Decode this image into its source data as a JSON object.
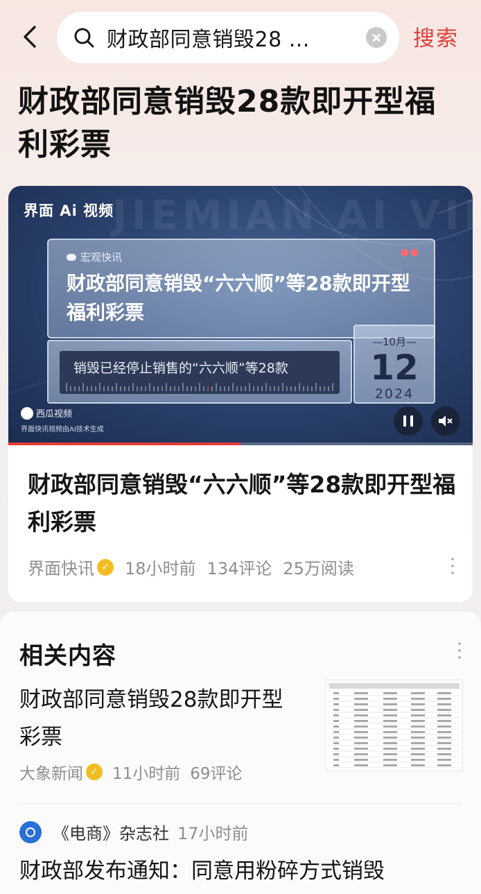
{
  "search": {
    "query": "财政部同意销毁28 ...",
    "submit_label": "搜索"
  },
  "page_title": "财政部同意销毁28款即开型福利彩票",
  "video": {
    "brand": "界面 Ai 视频",
    "watermark": "JIEMIAN AI VIDEO",
    "panel_tag": "宏观快讯",
    "panel_title": "财政部同意销毁“六六顺”等28款即开型福利彩票",
    "info_text": "销毁已经停止销售的“六六顺”等28款",
    "date_month": "—10月—",
    "date_day": "12",
    "date_year": "2024",
    "platform_label": "西瓜视频",
    "ai_note": "界面快讯视频由AI技术生成",
    "progress_fraction": 0.5
  },
  "article": {
    "title": "财政部同意销毁“六六顺”等28款即开型福利彩票",
    "source": "界面快讯",
    "time": "18小时前",
    "comments": "134评论",
    "reads": "25万阅读"
  },
  "related": {
    "section_title": "相关内容",
    "items": [
      {
        "title": "财政部同意销毁28款即开型彩票",
        "source": "大象新闻",
        "time": "11小时前",
        "comments": "69评论"
      },
      {
        "source": "《电商》杂志社",
        "time": "17小时前",
        "title": "财政部发布通知：同意用粉碎方式销毁"
      }
    ]
  },
  "colors": {
    "accent": "#e0403a",
    "verified_badge": "#f3bd22",
    "video_bg": "#2c4470"
  },
  "icons": [
    "back-arrow-icon",
    "search-icon",
    "clear-icon",
    "verified-icon",
    "more-icon",
    "pause-icon",
    "mute-icon",
    "xigua-logo-icon",
    "source-logo-icon"
  ]
}
